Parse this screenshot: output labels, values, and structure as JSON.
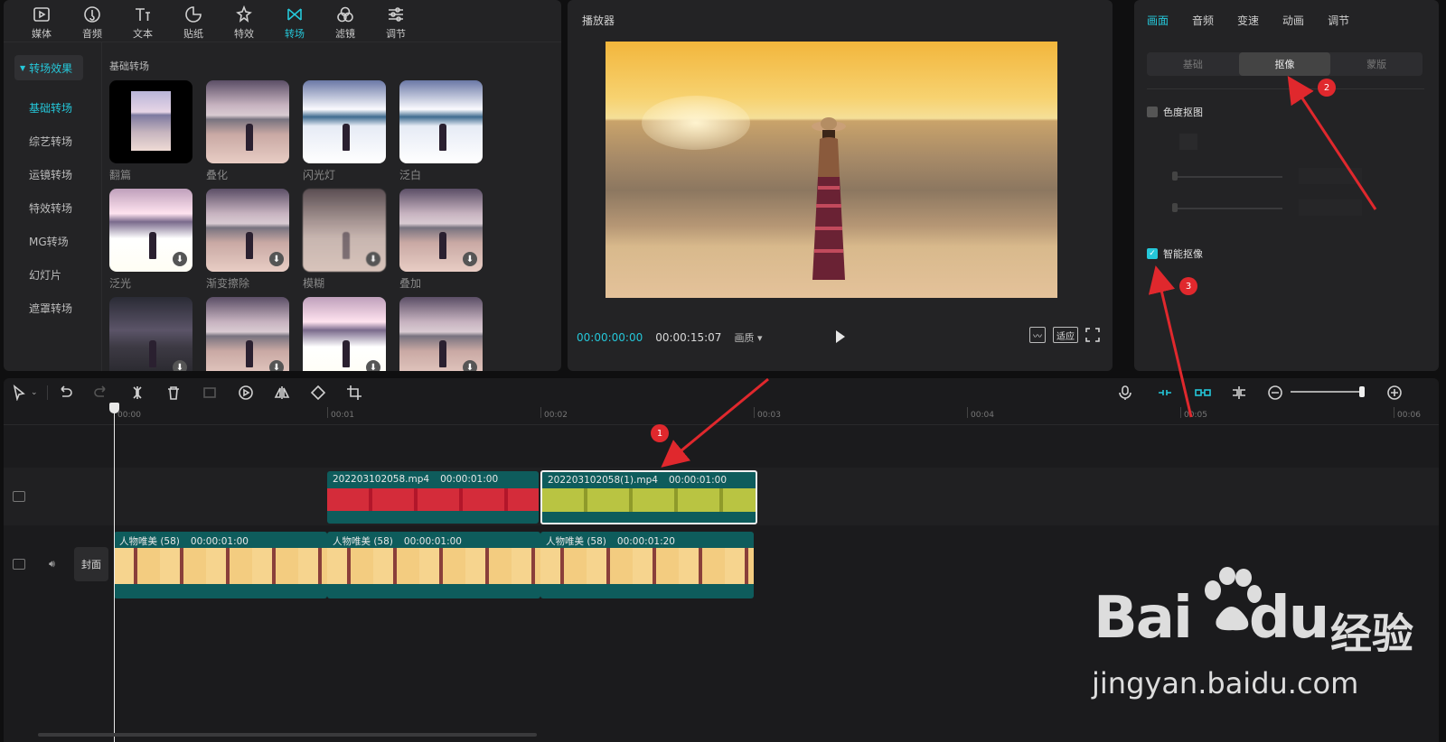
{
  "library": {
    "tools": [
      {
        "label": "媒体",
        "icon": "media-icon"
      },
      {
        "label": "音频",
        "icon": "audio-icon"
      },
      {
        "label": "文本",
        "icon": "text-icon"
      },
      {
        "label": "贴纸",
        "icon": "sticker-icon"
      },
      {
        "label": "特效",
        "icon": "effects-icon"
      },
      {
        "label": "转场",
        "icon": "transition-icon"
      },
      {
        "label": "滤镜",
        "icon": "filter-icon"
      },
      {
        "label": "调节",
        "icon": "adjust-icon"
      }
    ],
    "active_tool": "转场",
    "side_header": "转场效果",
    "side_items": [
      "基础转场",
      "综艺转场",
      "运镜转场",
      "特效转场",
      "MG转场",
      "幻灯片",
      "遮罩转场"
    ],
    "section_title": "基础转场",
    "thumbnails": [
      {
        "name": "翻篇",
        "download": false
      },
      {
        "name": "叠化",
        "download": false
      },
      {
        "name": "闪光灯",
        "download": false
      },
      {
        "name": "泛白",
        "download": false
      },
      {
        "name": "泛光",
        "download": true
      },
      {
        "name": "渐变擦除",
        "download": true
      },
      {
        "name": "模糊",
        "download": true
      },
      {
        "name": "叠加",
        "download": true
      },
      {
        "name": "",
        "download": true
      },
      {
        "name": "",
        "download": true
      },
      {
        "name": "",
        "download": true
      },
      {
        "name": "",
        "download": true
      }
    ]
  },
  "player": {
    "title": "播放器",
    "current_time": "00:00:00:00",
    "total_time": "00:00:15:07",
    "ratio_label": "画质",
    "fit_label": "适应"
  },
  "props": {
    "tabs": [
      "画面",
      "音频",
      "变速",
      "动画",
      "调节"
    ],
    "active_tab": "画面",
    "segments": [
      "基础",
      "抠像",
      "蒙版"
    ],
    "active_segment": "抠像",
    "chroma_key_label": "色度抠图",
    "smart_cutout_label": "智能抠像",
    "smart_cutout_checked": true
  },
  "timeline": {
    "ruler_labels": [
      "00:00",
      "00:01",
      "00:02",
      "00:03",
      "00:04",
      "00:05",
      "00:06"
    ],
    "overlay_clips": [
      {
        "name": "202203102058.mp4",
        "duration": "00:00:01:00"
      },
      {
        "name": "202203102058(1).mp4",
        "duration": "00:00:01:00"
      }
    ],
    "main_clips": [
      {
        "name": "人物唯美 (58)",
        "duration": "00:00:01:00"
      },
      {
        "name": "人物唯美 (58)",
        "duration": "00:00:01:00"
      },
      {
        "name": "人物唯美 (58)",
        "duration": "00:00:01:20"
      }
    ],
    "cover_label": "封面"
  },
  "annotations": [
    "1",
    "2",
    "3"
  ],
  "watermark": {
    "brand": "Bai",
    "brand2": "du",
    "jingyan": "经验",
    "url": "jingyan.baidu.com"
  },
  "colors": {
    "accent": "#25c7d9",
    "annotation": "#e0282d"
  }
}
